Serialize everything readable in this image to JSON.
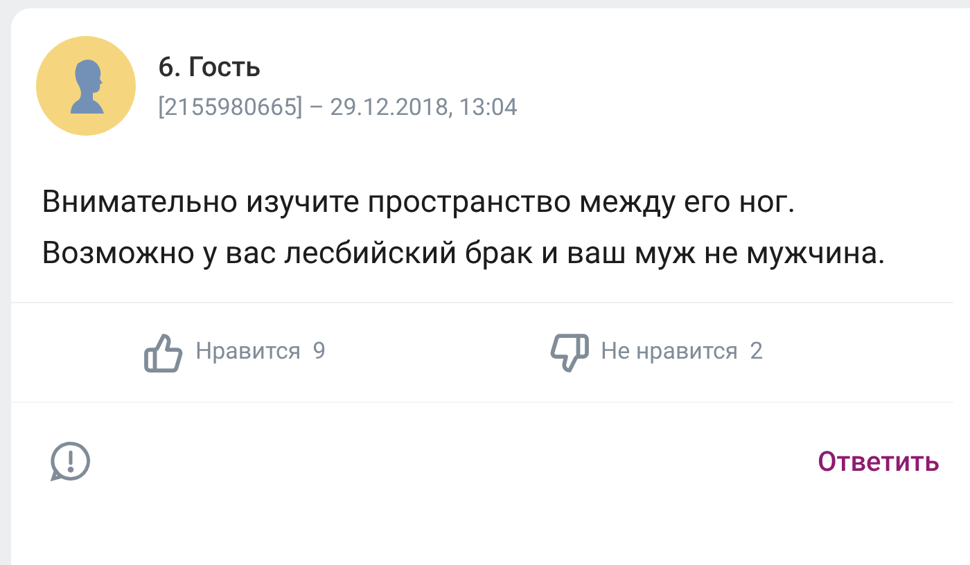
{
  "comment": {
    "author": "6. Гость",
    "meta": "[2155980665] – 29.12.2018, 13:04",
    "text": "Внимательно изучите пространство между его ног. Возможно у вас лесбийский брак и ваш муж не мужчина."
  },
  "reactions": [
    {
      "kind": "like",
      "label": "Нравится",
      "count": "9"
    },
    {
      "kind": "dislike",
      "label": "Не нравится",
      "count": "2"
    }
  ],
  "reply_button": "Ответить"
}
